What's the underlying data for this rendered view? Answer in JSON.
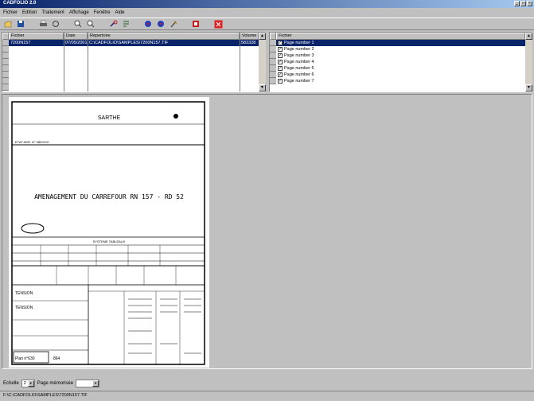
{
  "window": {
    "title": "CADFOLIO 2.0",
    "minimize": "_",
    "maximize": "□",
    "close": "×"
  },
  "menu": [
    "Fichier",
    "Edition",
    "Traitement",
    "Affichage",
    "Fenêtre",
    "Aide"
  ],
  "toolbar": {
    "icons": [
      "open-icon",
      "save-icon",
      "print-icon",
      "preview-icon",
      "zoom-in-icon",
      "zoom-out-icon",
      "rotate-icon",
      "flip-icon",
      "prev-icon",
      "next-icon",
      "tools-icon",
      "pdf-icon",
      "exit-icon"
    ]
  },
  "file_table": {
    "headers": [
      "Fichier",
      "Date",
      "Répertoire",
      "Volume"
    ],
    "rows": [
      {
        "fichier": "7200N157",
        "date": "07/05/2001",
        "repertoire": "C:\\CADFOLIO\\SAMPLES\\7200N157.TIF",
        "volume": "583328"
      }
    ]
  },
  "page_list": {
    "header": "Fichier",
    "items": [
      "Page number 1",
      "Page number 2",
      "Page number 3",
      "Page number 4",
      "Page number 5",
      "Page number 6",
      "Page number 7"
    ]
  },
  "document": {
    "department": "SARTHE",
    "subtitle": "AMENAGEMENT DU CARREFOUR RN 157 - RD 52",
    "reference": "Plan n°630",
    "sheet": "864"
  },
  "status": {
    "echelle_label": "Echelle",
    "echelle_value": "2",
    "page_label": "Page mémorisée",
    "page_value": ""
  },
  "path": "F:\\C:\\CADFOLIO\\SAMPLES\\7200N157.TIF"
}
